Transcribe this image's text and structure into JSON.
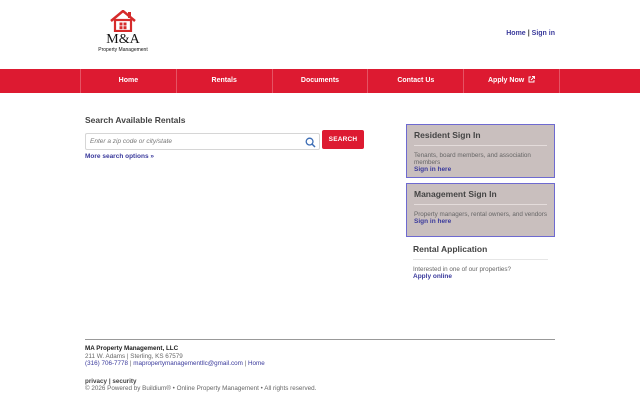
{
  "brand": {
    "logo_text": "M&A",
    "logo_sub": "Property Management",
    "logo_color": "#d62b2b"
  },
  "top_links": {
    "home": "Home",
    "separator": "|",
    "signin": "Sign in"
  },
  "nav": {
    "color": "#dd1a31",
    "items": [
      {
        "label": "Home"
      },
      {
        "label": "Rentals"
      },
      {
        "label": "Documents"
      },
      {
        "label": "Contact Us"
      },
      {
        "label": "Apply Now",
        "icon": "external-link-icon"
      }
    ]
  },
  "search": {
    "title": "Search Available Rentals",
    "placeholder": "Enter a zip code or city/state",
    "button_label": "SEARCH",
    "more_options": "More search options »",
    "icon": "search-icon"
  },
  "resident": {
    "title": "Resident Sign In",
    "description": "Tenants, board members, and association members",
    "link": "Sign in here"
  },
  "management": {
    "title": "Management Sign In",
    "description": "Property managers, rental owners, and vendors",
    "link": "Sign in here"
  },
  "rental_application": {
    "title": "Rental Application",
    "description": "Interested in one of our properties?",
    "link": "Apply online"
  },
  "footer": {
    "company": "MA Property Management, LLC",
    "address": "211 W. Adams | Sterling, KS 67579",
    "phone": "(316) 706-7778",
    "sep1": "|",
    "email": "mapropertymanagementllc@gmail.com",
    "sep2": "|",
    "home_link": "Home",
    "privacy": "privacy",
    "links_sep": "|",
    "security": "security",
    "copyright": "© 2026 Powered by Buildium® • Online Property Management • All rights reserved."
  }
}
